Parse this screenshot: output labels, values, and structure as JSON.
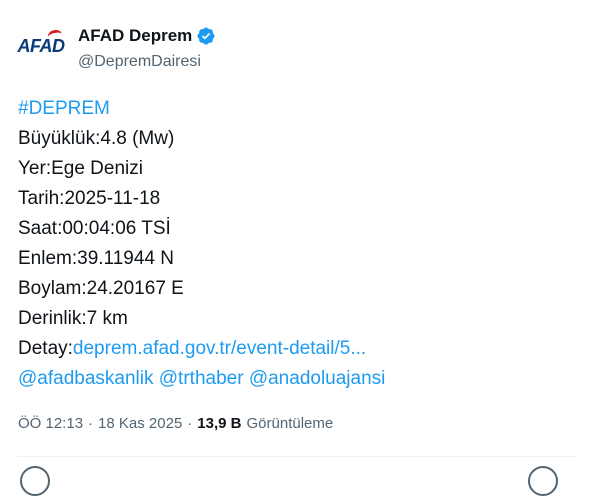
{
  "author": {
    "display_name": "AFAD Deprem",
    "handle": "@DepremDairesi",
    "avatar_text_main": "AFAD",
    "verified": true,
    "brand_color": "#0b3a7a",
    "accent_color": "#d71920"
  },
  "tweet": {
    "hashtag": "#DEPREM",
    "lines": [
      "Büyüklük:4.8 (Mw)",
      "Yer:Ege Denizi",
      "Tarih:2025-11-18",
      "Saat:00:04:06 TSİ",
      "Enlem:39.11944 N",
      "Boylam:24.20167 E",
      "Derinlik:7 km"
    ],
    "detail_label": "Detay:",
    "detail_link": "deprem.afad.gov.tr/event-detail/5...",
    "mentions": [
      "@afadbaskanlik",
      "@trthaber",
      "@anadoluajansi"
    ],
    "link_color": "#1d9bf0"
  },
  "meta": {
    "time": "ÖÖ 12:13",
    "separator": "·",
    "date": "18 Kas 2025",
    "views_count": "13,9 B",
    "views_label": "Görüntüleme"
  }
}
